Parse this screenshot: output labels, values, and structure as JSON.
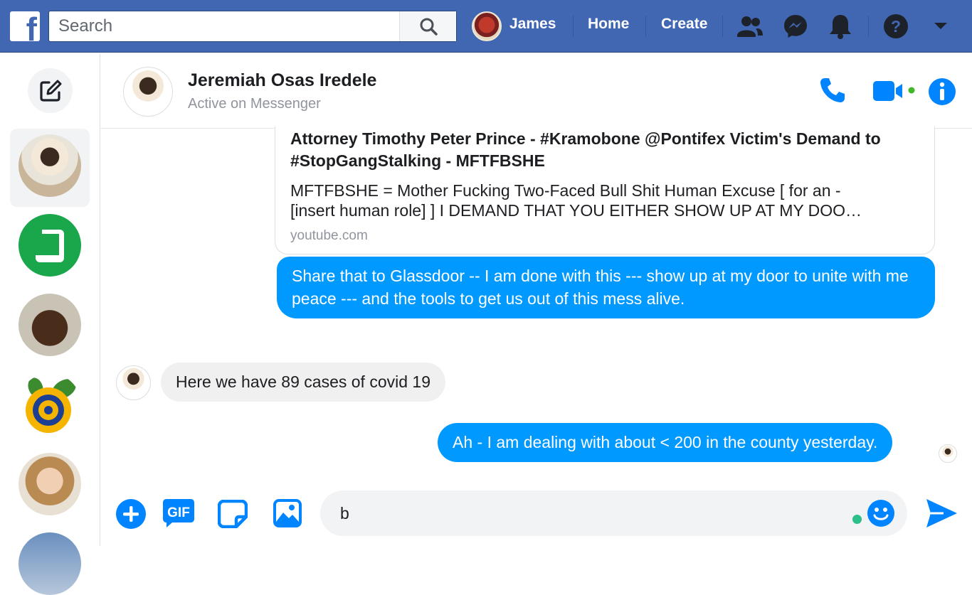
{
  "topbar": {
    "search_placeholder": "Search",
    "user_name": "James",
    "home_label": "Home",
    "create_label": "Create",
    "brand_color": "#4267b2"
  },
  "conversation": {
    "name": "Jeremiah Osas Iredele",
    "status": "Active on Messenger"
  },
  "messages": {
    "link_card": {
      "title": "Attorney Timothy Peter Prince - #Kramobone @Pontifex Victim's Demand to #StopGangStalking - MFTFBSHE",
      "description_line1": "MFTFBSHE = Mother Fucking Two-Faced Bull Shit Human Excuse [ for an -",
      "description_line2": "[insert human role] ] I DEMAND THAT YOU EITHER SHOW UP AT MY DOO…",
      "source": "youtube.com"
    },
    "outgoing_1": "Share that to Glassdoor -- I am done with this --- show up at my door to unite with me peace --- and the tools to get us out of this mess alive.",
    "incoming_1": "Here we have 89 cases of covid 19",
    "outgoing_2": "Ah - I am dealing with about < 200 in the county yesterday."
  },
  "composer": {
    "value": "b",
    "gif_label": "GIF"
  },
  "colors": {
    "messenger_blue": "#0099ff",
    "icon_blue": "#0084ff",
    "active_green": "#42b72a"
  }
}
